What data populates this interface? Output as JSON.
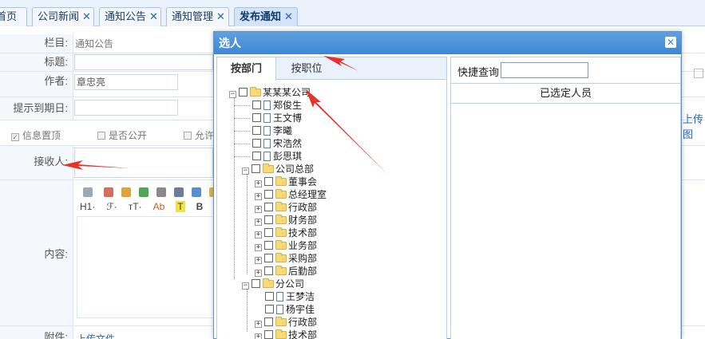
{
  "tabs": [
    {
      "label": "首页",
      "closable": false
    },
    {
      "label": "公司新闻",
      "closable": true
    },
    {
      "label": "通知公告",
      "closable": true
    },
    {
      "label": "通知管理",
      "closable": true
    },
    {
      "label": "发布通知",
      "closable": true,
      "active": true
    }
  ],
  "tab_close_glyph": "✕",
  "form": {
    "column_label": "栏目:",
    "column_value": "通知公告",
    "title_label": "标题:",
    "author_label": "作者:",
    "author_value": "章忠亮",
    "due_label": "提示到期日:",
    "opt_top": "信息置顶",
    "opt_public": "是否公开",
    "opt_allow": "允许",
    "recipient_label": "接收人:",
    "content_label": "内容:",
    "attachment_label": "附件:",
    "attachment_link": "上传文件",
    "upload_link_right": "上传图",
    "editor_row2": [
      "H1·",
      "ℱ·",
      "тT·",
      "Ab",
      "T",
      "B"
    ]
  },
  "modal": {
    "title": "选人",
    "close_glyph": "✕",
    "tab_by_dept": "按部门",
    "tab_by_position": "按职位",
    "quick_search_label": "快捷查询",
    "quick_search_value": "",
    "selected_header": "已选定人员",
    "tree": {
      "root": "某某某公司",
      "root_people": [
        "郑俊生",
        "王文博",
        "李曦",
        "宋浩然",
        "彭思琪"
      ],
      "hq": "公司总部",
      "hq_depts": [
        "董事会",
        "总经理室",
        "行政部",
        "财务部",
        "技术部",
        "业务部",
        "采购部",
        "后勤部"
      ],
      "branch": "分公司",
      "branch_people": [
        "王梦洁",
        "杨宇佳"
      ],
      "branch_depts": [
        "行政部",
        "技术部"
      ]
    }
  },
  "colors": {
    "accent": "#3f86d2",
    "arrow": "#e8312a"
  }
}
